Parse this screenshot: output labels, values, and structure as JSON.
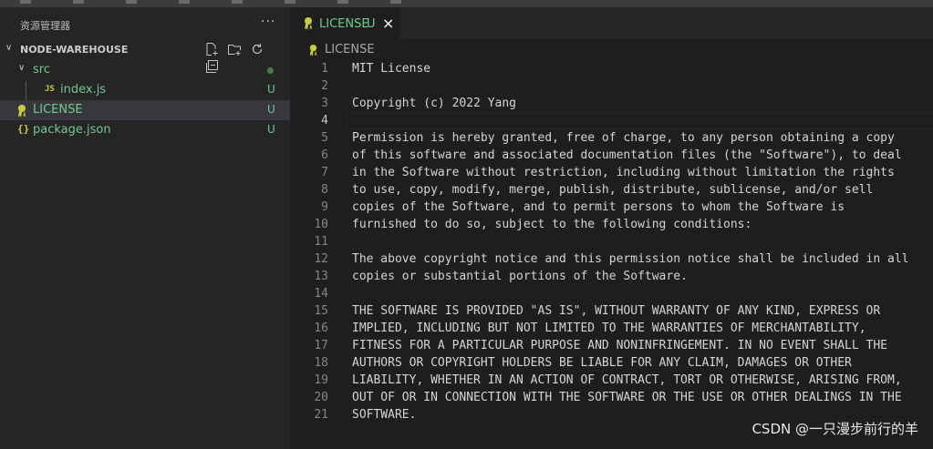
{
  "sidebar": {
    "title": "资源管理器",
    "more_label": "···",
    "section_title": "NODE-WAREHOUSE",
    "actions": [
      "new-file-icon",
      "new-folder-icon",
      "refresh-icon",
      "collapse-all-icon"
    ],
    "tree": {
      "src": {
        "label": "src"
      },
      "index": {
        "label": "index.js",
        "icon_text": "JS",
        "git": "U"
      },
      "license": {
        "label": "LICENSE",
        "git": "U"
      },
      "package": {
        "label": "package.json",
        "icon_text": "{}",
        "git": "U"
      }
    }
  },
  "editor": {
    "tab": {
      "label": "LICENSE",
      "git": "U",
      "close": "×"
    },
    "breadcrumb": "LICENSE",
    "lines": [
      "MIT License",
      "",
      "Copyright (c) 2022 Yang",
      "",
      "Permission is hereby granted, free of charge, to any person obtaining a copy",
      "of this software and associated documentation files (the \"Software\"), to deal",
      "in the Software without restriction, including without limitation the rights",
      "to use, copy, modify, merge, publish, distribute, sublicense, and/or sell",
      "copies of the Software, and to permit persons to whom the Software is",
      "furnished to do so, subject to the following conditions:",
      "",
      "The above copyright notice and this permission notice shall be included in all",
      "copies or substantial portions of the Software.",
      "",
      "THE SOFTWARE IS PROVIDED \"AS IS\", WITHOUT WARRANTY OF ANY KIND, EXPRESS OR",
      "IMPLIED, INCLUDING BUT NOT LIMITED TO THE WARRANTIES OF MERCHANTABILITY,",
      "FITNESS FOR A PARTICULAR PURPOSE AND NONINFRINGEMENT. IN NO EVENT SHALL THE",
      "AUTHORS OR COPYRIGHT HOLDERS BE LIABLE FOR ANY CLAIM, DAMAGES OR OTHER",
      "LIABILITY, WHETHER IN AN ACTION OF CONTRACT, TORT OR OTHERWISE, ARISING FROM,",
      "OUT OF OR IN CONNECTION WITH THE SOFTWARE OR THE USE OR OTHER DEALINGS IN THE",
      "SOFTWARE."
    ],
    "current_line": 4
  },
  "watermark": "CSDN @一只漫步前行的羊",
  "colors": {
    "git_untracked": "#73c991",
    "accent_icon": "#cbcb41"
  }
}
